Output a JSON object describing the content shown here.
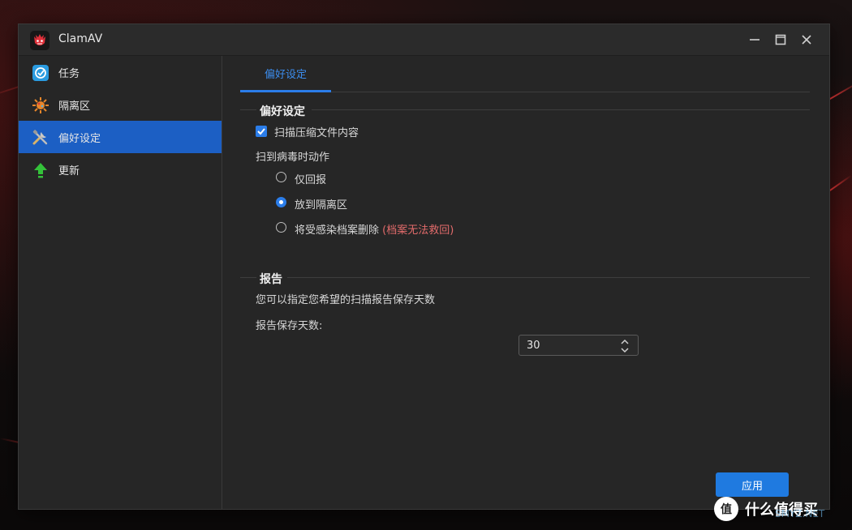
{
  "window": {
    "title": "ClamAV"
  },
  "sidebar": {
    "items": [
      {
        "label": "任务",
        "icon": "task-check-icon",
        "active": false
      },
      {
        "label": "隔离区",
        "icon": "quarantine-virus-icon",
        "active": false
      },
      {
        "label": "偏好设定",
        "icon": "tools-wrench-icon",
        "active": true
      },
      {
        "label": "更新",
        "icon": "update-arrow-icon",
        "active": false
      }
    ]
  },
  "main": {
    "tab_label": "偏好设定",
    "preferences": {
      "title": "偏好设定",
      "scan_archive_label": "扫描压缩文件内容",
      "scan_archive_checked": true,
      "virus_action_label": "扫到病毒时动作",
      "options": [
        {
          "label": "仅回报",
          "selected": false
        },
        {
          "label": "放到隔离区",
          "selected": true
        },
        {
          "label": "将受感染档案删除",
          "note": "(档案无法救回)",
          "selected": false
        }
      ]
    },
    "report": {
      "title": "报告",
      "description": "您可以指定您希望的扫描报告保存天数",
      "days_label": "报告保存天数:",
      "days_value": "30"
    },
    "apply_label": "应用"
  },
  "watermark": {
    "text": "什么值得买",
    "sub": "SMYZ.NET"
  },
  "colors": {
    "accent": "#2b7de9",
    "active_nav": "#1c5fc4",
    "warning": "#e26b6b",
    "panel": "#262626"
  }
}
